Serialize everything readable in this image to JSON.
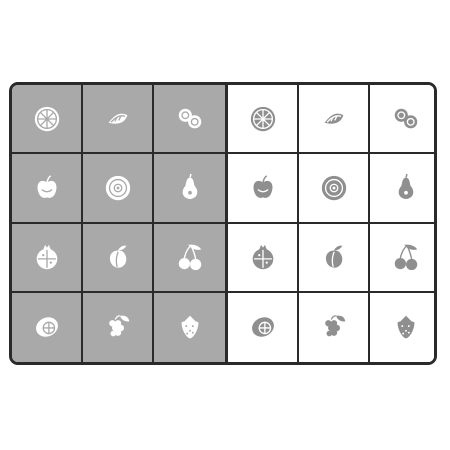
{
  "board": {
    "left_panel": {
      "style": "light-icons-on-gray",
      "background": "#a9a9a9",
      "icon_color": "#ffffff",
      "icons": [
        "orange-slice-icon",
        "lemon-wedge-icon",
        "nuts-icon",
        "apple-icon",
        "kiwi-icon",
        "pear-icon",
        "pomegranate-icon",
        "peach-icon",
        "cherries-icon",
        "lemon-icon",
        "grapes-icon",
        "strawberry-icon"
      ]
    },
    "right_panel": {
      "style": "gray-icons-on-white",
      "background": "#ffffff",
      "icon_color": "#8f8f8f",
      "icons": [
        "orange-slice-icon",
        "lemon-wedge-icon",
        "nuts-icon",
        "apple-icon",
        "kiwi-icon",
        "pear-icon",
        "pomegranate-icon",
        "peach-icon",
        "cherries-icon",
        "lemon-icon",
        "grapes-icon",
        "strawberry-icon"
      ]
    },
    "border_color": "#2a2a2a"
  }
}
